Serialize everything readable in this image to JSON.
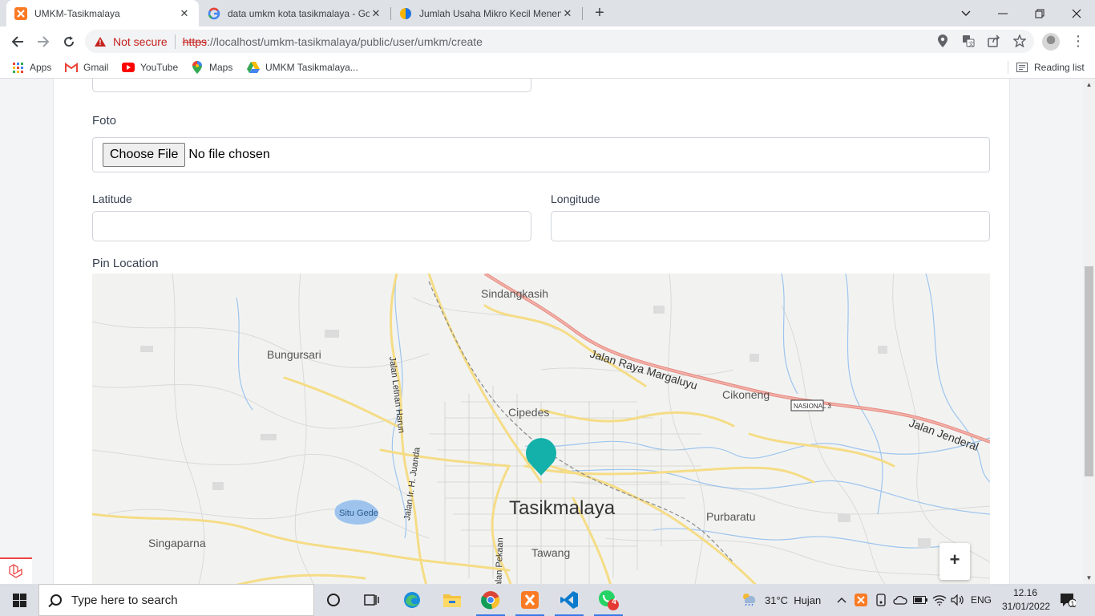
{
  "browser": {
    "tabs": [
      {
        "title": "UMKM-Tasikmalaya",
        "favicon": "xampp-icon",
        "active": true
      },
      {
        "title": "data umkm kota tasikmalaya - Go",
        "favicon": "google-icon",
        "active": false
      },
      {
        "title": "Jumlah Usaha Mikro Kecil Menen",
        "favicon": "data-site-icon",
        "active": false
      }
    ],
    "security_label": "Not secure",
    "url_scheme": "https",
    "url_rest": "://localhost/umkm-tasikmalaya/public/user/umkm/create",
    "bookmarks": [
      {
        "label": "Apps",
        "icon": "apps-grid-icon"
      },
      {
        "label": "Gmail",
        "icon": "gmail-icon"
      },
      {
        "label": "YouTube",
        "icon": "youtube-icon"
      },
      {
        "label": "Maps",
        "icon": "maps-pin-icon"
      },
      {
        "label": "UMKM Tasikmalaya...",
        "icon": "google-drive-icon"
      }
    ],
    "reading_list": "Reading list"
  },
  "form": {
    "foto_label": "Foto",
    "file_button": "Choose File",
    "file_status": "No file chosen",
    "latitude_label": "Latitude",
    "latitude_value": "",
    "longitude_label": "Longitude",
    "longitude_value": "",
    "pin_label": "Pin Location",
    "zoom_in": "+"
  },
  "map": {
    "places": [
      "Sindangkasih",
      "Bungursari",
      "Jalan Letnan Harun",
      "Jalan Raya Margaluyu",
      "Cikoneng",
      "NASIONAL 3",
      "Jalan Jenderal",
      "Cipedes",
      "Situ Gede",
      "Jalan Ir. H. Juanda",
      "Tasikmalaya",
      "Purbaratu",
      "Singaparna",
      "Tawang",
      "Jalan Pekaan"
    ],
    "marker_color": "#14b0aa"
  },
  "taskbar": {
    "search_placeholder": "Type here to search",
    "whatsapp_badge": "4",
    "weather": "31°C  Hujan",
    "language": "ENG",
    "time": "12.16",
    "date": "31/01/2022",
    "notification_count": "1"
  }
}
